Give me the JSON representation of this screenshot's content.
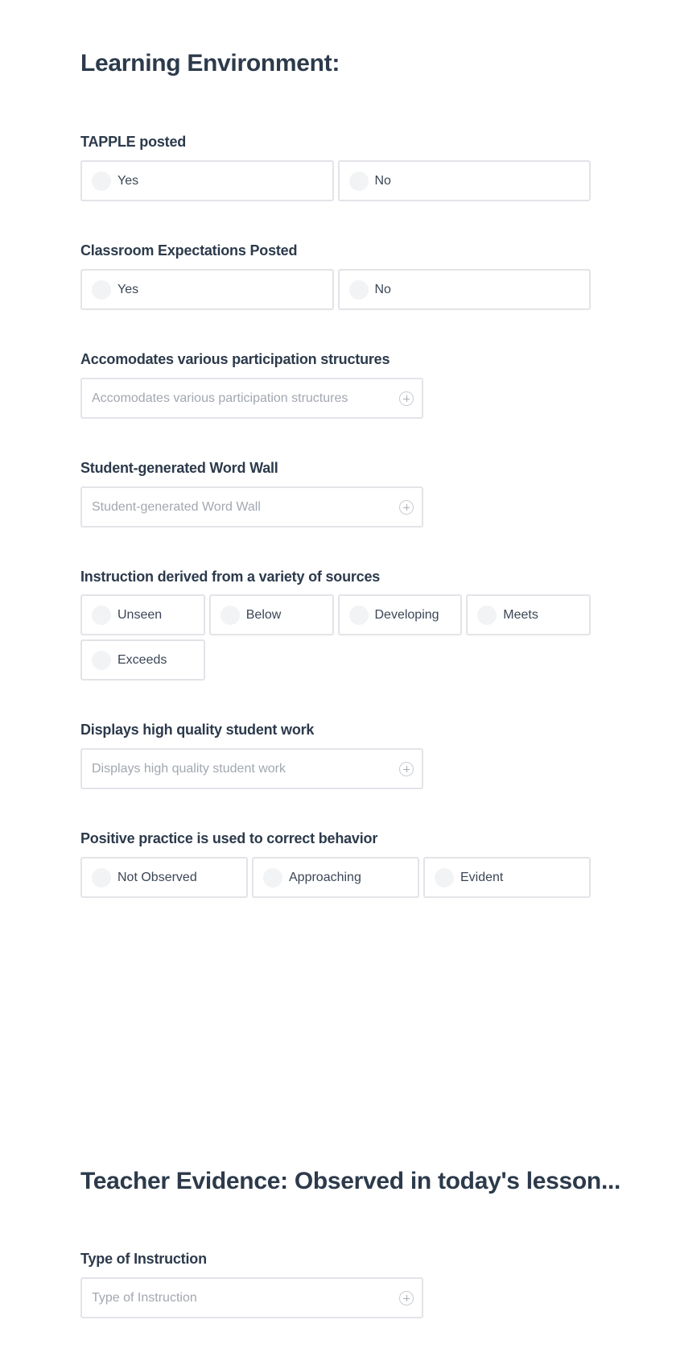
{
  "sections": [
    {
      "title": "Learning Environment:",
      "questions": [
        {
          "label": "TAPPLE posted",
          "type": "radio",
          "options": [
            "Yes",
            "No"
          ]
        },
        {
          "label": "Classroom Expectations Posted",
          "type": "radio",
          "options": [
            "Yes",
            "No"
          ]
        },
        {
          "label": "Accomodates various participation structures",
          "type": "select",
          "placeholder": "Accomodates various participation structures",
          "icon": "plus-circle-icon"
        },
        {
          "label": "Student-generated Word Wall",
          "type": "select",
          "placeholder": "Student-generated Word Wall",
          "icon": "plus-circle-icon"
        },
        {
          "label": "Instruction derived from a variety of sources",
          "type": "radio",
          "options": [
            "Unseen",
            "Below",
            "Developing",
            "Meets",
            "Exceeds"
          ]
        },
        {
          "label": "Displays high quality student work",
          "type": "select",
          "placeholder": "Displays high quality student work",
          "icon": "plus-circle-icon"
        },
        {
          "label": "Positive practice is used to correct behavior",
          "type": "radio",
          "options": [
            "Not Observed",
            "Approaching",
            "Evident"
          ]
        }
      ]
    },
    {
      "title": "Teacher Evidence: Observed in today's lesson...",
      "questions": [
        {
          "label": "Type of Instruction",
          "type": "select",
          "placeholder": "Type of Instruction",
          "icon": "plus-circle-icon"
        }
      ]
    }
  ],
  "colors": {
    "heading": "#2c3a4b",
    "option_text": "#3b4656",
    "placeholder": "#a2a7b0",
    "border": "#e3e4e8",
    "radio_fill": "#f2f3f5"
  }
}
